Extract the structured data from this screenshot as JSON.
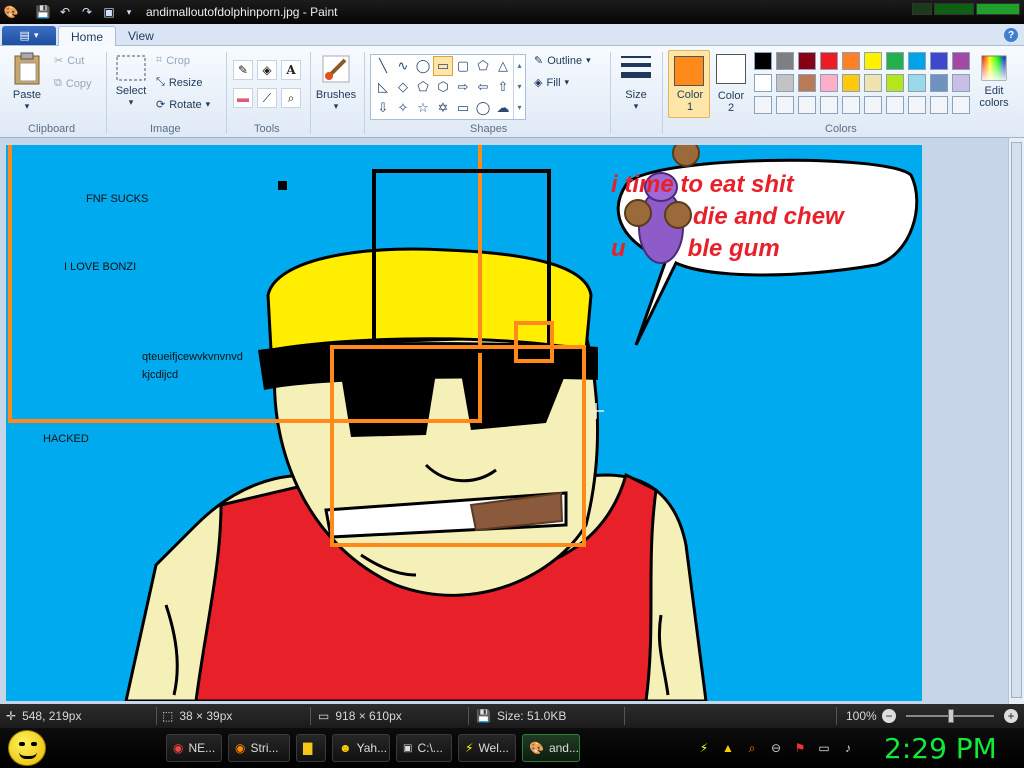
{
  "window": {
    "title": "andimalloutofdolphinporn.jpg - Paint"
  },
  "tabs": {
    "home": "Home",
    "view": "View",
    "help": "?"
  },
  "clipboard": {
    "paste": "Paste",
    "cut": "Cut",
    "copy": "Copy",
    "label": "Clipboard"
  },
  "image": {
    "select": "Select",
    "crop": "Crop",
    "resize": "Resize",
    "rotate": "Rotate",
    "label": "Image"
  },
  "tools": {
    "label": "Tools",
    "text_tool": "A"
  },
  "brushes": {
    "label": "Brushes"
  },
  "shapes": {
    "label": "Shapes",
    "outline": "Outline",
    "fill": "Fill"
  },
  "size": {
    "label": "Size"
  },
  "colors": {
    "color1_line1": "Color",
    "color1_line2": "1",
    "color2_line1": "Color",
    "color2_line2": "2",
    "edit_line1": "Edit",
    "edit_line2": "colors",
    "label": "Colors",
    "color1_value": "#ff8a1a",
    "color2_value": "#ffffff",
    "palette": [
      "#000000",
      "#7f7f7f",
      "#880015",
      "#ed1c24",
      "#ff7f27",
      "#fff200",
      "#22b14c",
      "#00a2e8",
      "#3f48cc",
      "#a349a4",
      "#ffffff",
      "#c3c3c3",
      "#b97a57",
      "#ffaec9",
      "#ffc90e",
      "#efe4b0",
      "#b5e61d",
      "#99d9ea",
      "#7092be",
      "#c8bfe7"
    ]
  },
  "canvas": {
    "bg": "#00aaee",
    "texts": {
      "t1": "FNF SUCKS",
      "t2": "I LOVE BONZI",
      "t3": "qteueifjcewvkvnvnvd",
      "t4": "kjcdijcd",
      "t5": "HACKED"
    },
    "bubble": {
      "line1": "time to eat shit",
      "line2": "die and chew",
      "line3": "ble gum",
      "prefix1": "i",
      "prefix3": "u"
    }
  },
  "status": {
    "cursor": "548, 219px",
    "selection": "38 × 39px",
    "image_size": "918 × 610px",
    "file_size": "Size: 51.0KB",
    "zoom": "100%"
  },
  "taskbar": {
    "tasks": [
      "NE...",
      "Stri...",
      "",
      "Yah...",
      "C:\\...",
      "Wel...",
      "and..."
    ],
    "clock": "2:29 PM"
  }
}
